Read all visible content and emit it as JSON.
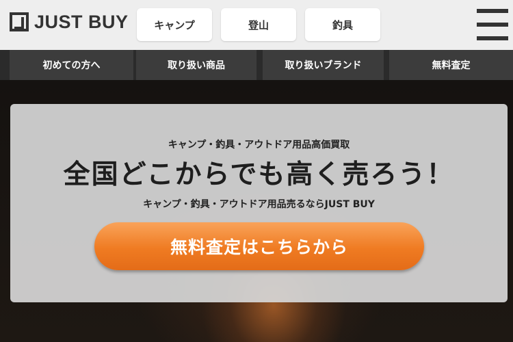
{
  "header": {
    "logo_text": "JUST BUY",
    "category_buttons": [
      "キャンプ",
      "登山",
      "釣具"
    ],
    "menu_icon": "hamburger-menu-icon"
  },
  "nav": {
    "items": [
      "初めての方へ",
      "取り扱い商品",
      "取り扱いブランド",
      "無料査定"
    ]
  },
  "hero": {
    "subtitle_top": "キャンプ・釣具・アウトドア用品高価買取",
    "headline": "全国どこからでも高く売ろう！",
    "subtitle_bottom": "キャンプ・釣具・アウトドア用品売るならJUST BUY",
    "cta_label": "無料査定はこちらから"
  },
  "colors": {
    "cta_orange": "#ef7b22",
    "nav_bg": "#3c3c3c",
    "header_bg": "#eeeeee"
  }
}
